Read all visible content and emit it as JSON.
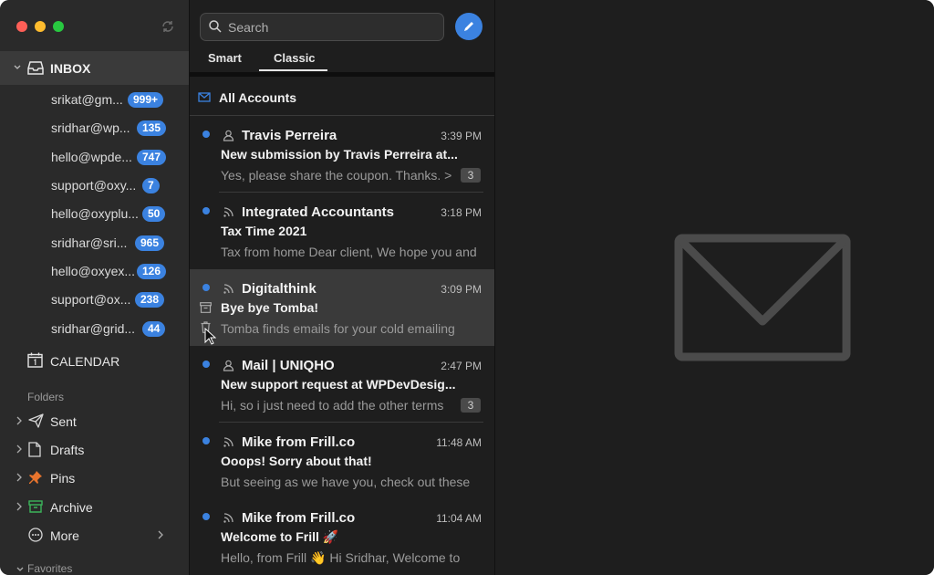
{
  "colors": {
    "accent": "#3b82e0",
    "unread": "#3b82e0"
  },
  "sidebar": {
    "inbox_label": "INBOX",
    "accounts": [
      {
        "name": "srikat@gm...",
        "count": "999+"
      },
      {
        "name": "sridhar@wp...",
        "count": "135"
      },
      {
        "name": "hello@wpde...",
        "count": "747"
      },
      {
        "name": "support@oxy...",
        "count": "7"
      },
      {
        "name": "hello@oxyplu...",
        "count": "50"
      },
      {
        "name": "sridhar@sri...",
        "count": "965"
      },
      {
        "name": "hello@oxyex...",
        "count": "126"
      },
      {
        "name": "support@ox...",
        "count": "238"
      },
      {
        "name": "sridhar@grid...",
        "count": "44"
      }
    ],
    "calendar_label": "CALENDAR",
    "folders_heading": "Folders",
    "folders": [
      {
        "label": "Sent",
        "icon": "send-icon"
      },
      {
        "label": "Drafts",
        "icon": "document-icon"
      },
      {
        "label": "Pins",
        "icon": "pin-icon"
      },
      {
        "label": "Archive",
        "icon": "archive-icon"
      },
      {
        "label": "More",
        "icon": "more-icon"
      }
    ],
    "favorites_heading": "Favorites"
  },
  "list": {
    "search_placeholder": "Search",
    "tabs": [
      {
        "label": "Smart"
      },
      {
        "label": "Classic"
      }
    ],
    "active_tab": "Classic",
    "all_accounts_label": "All Accounts",
    "messages": [
      {
        "sender": "Travis Perreira",
        "sender_icon": "person-icon",
        "time": "3:39 PM",
        "subject": "New submission by Travis Perreira at...",
        "preview": "Yes, please share the coupon. Thanks. >",
        "thread_count": "3",
        "unread": true
      },
      {
        "sender": "Integrated Accountants",
        "sender_icon": "rss-icon",
        "time": "3:18 PM",
        "subject": "Tax Time 2021",
        "preview": "Tax from home Dear client, We hope you and",
        "unread": true
      },
      {
        "sender": "Digitalthink",
        "sender_icon": "rss-icon",
        "time": "3:09 PM",
        "subject": "Bye bye Tomba!",
        "preview": "Tomba finds emails for your cold emailing",
        "unread": true,
        "hovered": true
      },
      {
        "sender": "Mail | UNIQHO",
        "sender_icon": "person-icon",
        "time": "2:47 PM",
        "subject": "New support request at WPDevDesig...",
        "preview": "Hi, so i just need to add the other terms",
        "thread_count": "3",
        "unread": true
      },
      {
        "sender": "Mike from Frill.co",
        "sender_icon": "rss-icon",
        "time": "11:48 AM",
        "subject": "Ooops! Sorry about that!",
        "preview": "But seeing as we have you, check out these",
        "unread": true
      },
      {
        "sender": "Mike from Frill.co",
        "sender_icon": "rss-icon",
        "time": "11:04 AM",
        "subject": "Welcome to Frill 🚀",
        "preview": "Hello, from Frill 👋 Hi Sridhar, Welcome to",
        "unread": true
      }
    ]
  },
  "pane": {
    "placeholder_icon": "envelope-icon"
  }
}
